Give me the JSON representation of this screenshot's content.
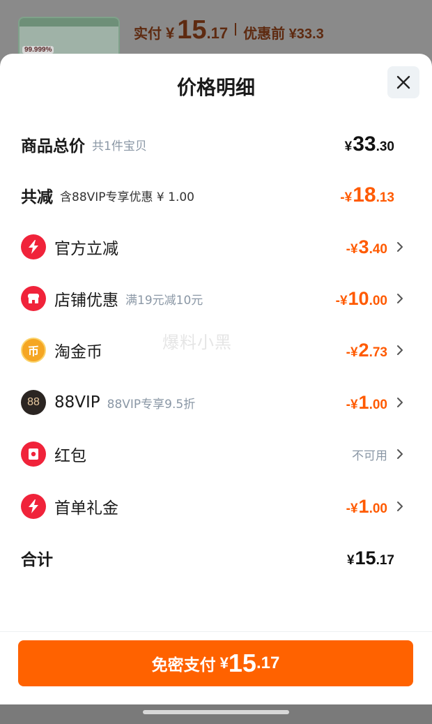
{
  "background": {
    "thumb_badge": "99.999%",
    "paid_label": "实付",
    "yen": "¥",
    "paid_int": "15",
    "paid_dec": ".17",
    "before_label": "优惠前 ¥33.3"
  },
  "sheet": {
    "title": "价格明细",
    "close_icon": "close-icon"
  },
  "rows": {
    "total": {
      "label": "商品总价",
      "sub": "共1件宝贝",
      "yen": "¥",
      "int": "33",
      "dec": ".30"
    },
    "discount": {
      "label": "共减",
      "sub": "含88VIP专享优惠 ¥ 1.00",
      "yen": "-¥",
      "int": "18",
      "dec": ".13"
    },
    "official": {
      "label": "官方立减",
      "icon": "lightning-icon",
      "yen": "-¥",
      "int": "3",
      "dec": ".40"
    },
    "store": {
      "label": "店铺优惠",
      "sub": "满19元减10元",
      "icon": "store-icon",
      "yen": "-¥",
      "int": "10",
      "dec": ".00"
    },
    "coin": {
      "label": "淘金币",
      "icon": "coin-icon",
      "icon_char": "币",
      "yen": "-¥",
      "int": "2",
      "dec": ".73"
    },
    "vip": {
      "label": "88VIP",
      "sub": "88VIP专享9.5折",
      "icon": "vip-icon",
      "icon_char": "88",
      "yen": "-¥",
      "int": "1",
      "dec": ".00"
    },
    "redpacket": {
      "label": "红包",
      "icon": "red-packet-icon",
      "status": "不可用"
    },
    "firstorder": {
      "label": "首单礼金",
      "icon": "lightning-icon",
      "yen": "-¥",
      "int": "1",
      "dec": ".00"
    },
    "sum": {
      "label": "合计",
      "yen": "¥",
      "int": "15",
      "dec": ".17"
    }
  },
  "watermark": "爆料小黑",
  "pay_button": {
    "label": "免密支付",
    "yen": "¥",
    "int": "15",
    "dec": ".17"
  },
  "colors": {
    "accent": "#ff6200",
    "discount": "#ff5a00",
    "muted": "#8a97a5",
    "icon_red": "#f0233a",
    "coin": "#f5a623",
    "vip": "#2b2522"
  }
}
